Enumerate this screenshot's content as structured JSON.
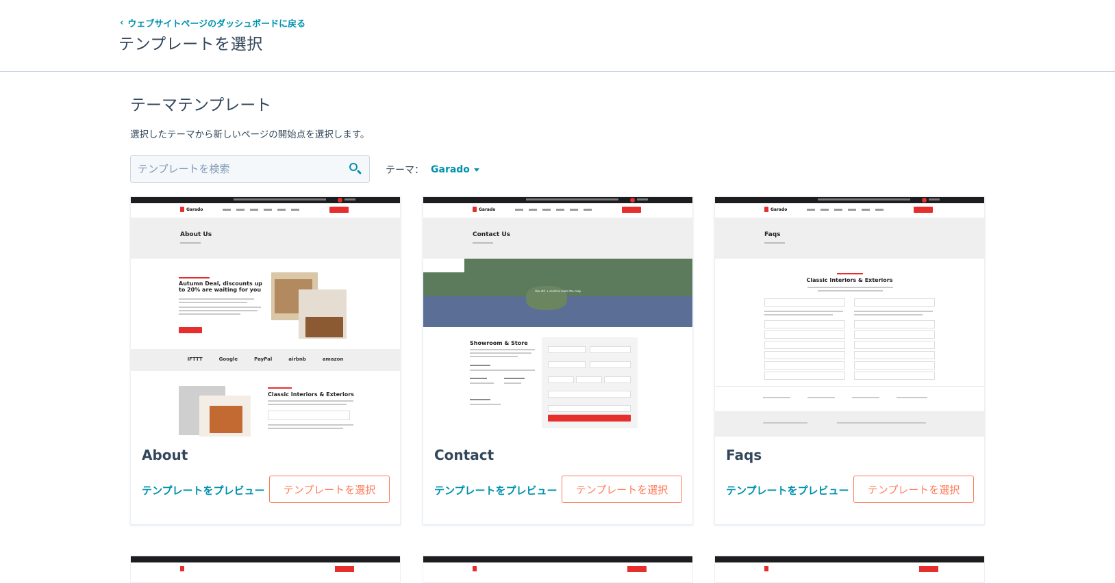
{
  "header": {
    "back_label": "ウェブサイトページのダッシュボードに戻る",
    "title": "テンプレートを選択"
  },
  "section": {
    "title": "テーマテンプレート",
    "description": "選択したテーマから新しいページの開始点を選択します。"
  },
  "search": {
    "placeholder": "テンプレートを検索",
    "icon": "search-icon"
  },
  "theme_filter": {
    "label": "テーマ：",
    "value": "Garado"
  },
  "cards": [
    {
      "name": "About",
      "preview_label": "テンプレートをプレビュー",
      "select_label": "テンプレートを選択"
    },
    {
      "name": "Contact",
      "preview_label": "テンプレートをプレビュー",
      "select_label": "テンプレートを選択"
    },
    {
      "name": "Faqs",
      "preview_label": "テンプレートをプレビュー",
      "select_label": "テンプレートを選択"
    }
  ],
  "thumbnails": {
    "logo": "Garado",
    "about": {
      "hero": "About Us",
      "headline": "Autumn Deal, discounts up to 20% are waiting for you",
      "brands": [
        "IFTTT",
        "Google",
        "PayPal",
        "airbnb",
        "amazon"
      ],
      "section2": "Classic Interiors & Exteriors"
    },
    "contact": {
      "hero": "Contact Us",
      "map_hint": "Use ctrl + scroll to zoom the map",
      "store": "Showroom & Store"
    },
    "faqs": {
      "hero": "Faqs",
      "section": "Classic Interiors & Exteriors"
    }
  },
  "colors": {
    "link": "#0091ae",
    "accent": "#ff7a59",
    "text": "#33475b",
    "garado_red": "#e62e2d"
  }
}
